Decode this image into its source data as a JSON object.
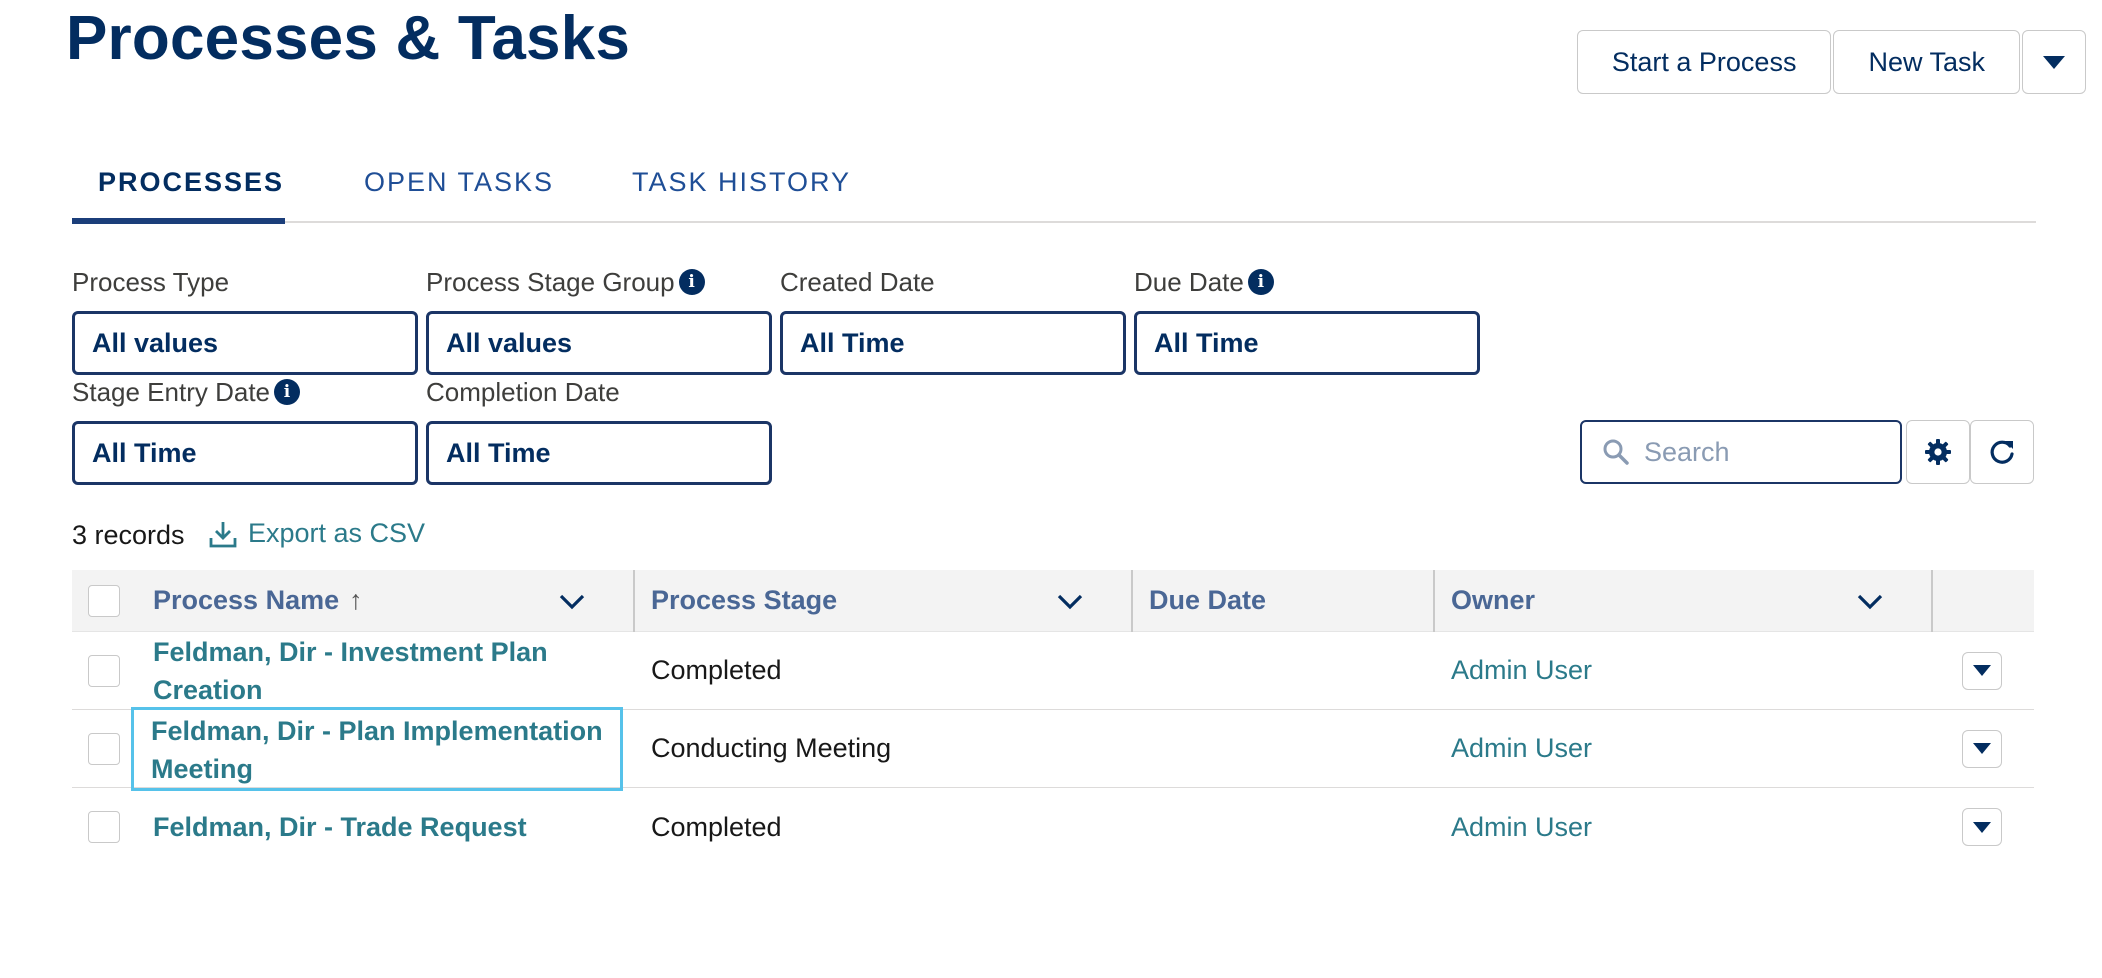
{
  "page": {
    "title": "Processes & Tasks"
  },
  "header_actions": {
    "start_process": "Start a Process",
    "new_task": "New Task"
  },
  "tabs": [
    {
      "label": "PROCESSES",
      "active": true
    },
    {
      "label": "OPEN TASKS",
      "active": false
    },
    {
      "label": "TASK HISTORY",
      "active": false
    }
  ],
  "filters": [
    {
      "label": "Process Type",
      "value": "All values",
      "info": false
    },
    {
      "label": "Process Stage Group",
      "value": "All values",
      "info": true
    },
    {
      "label": "Created Date",
      "value": "All Time",
      "info": false
    },
    {
      "label": "Due Date",
      "value": "All Time",
      "info": true
    },
    {
      "label": "Stage Entry Date",
      "value": "All Time",
      "info": true
    },
    {
      "label": "Completion Date",
      "value": "All Time",
      "info": false
    }
  ],
  "search": {
    "placeholder": "Search"
  },
  "records": {
    "count_text": "3 records",
    "export_label": "Export as CSV"
  },
  "table": {
    "columns": [
      "Process Name",
      "Process Stage",
      "Due Date",
      "Owner"
    ],
    "sort_indicator": "↑",
    "rows": [
      {
        "name_line1": "Feldman, Dir - Investment Plan",
        "name_line2": "Creation",
        "stage": "Completed",
        "due_date": "",
        "owner": "Admin User"
      },
      {
        "name_line1": "Feldman, Dir - Plan Implementation",
        "name_line2": "Meeting",
        "stage": "Conducting Meeting",
        "due_date": "",
        "owner": "Admin User"
      },
      {
        "name_line1": "Feldman, Dir - Trade Request",
        "name_line2": "",
        "stage": "Completed",
        "due_date": "",
        "owner": "Admin User"
      }
    ]
  },
  "colors": {
    "brand_navy": "#032d60",
    "link_teal": "#2b7a8a",
    "focus_ring": "#56c2ea"
  },
  "icons": [
    "caret-down-icon",
    "info-icon",
    "search-icon",
    "gear-icon",
    "refresh-icon",
    "download-icon",
    "chevron-down-icon",
    "sort-arrow-up-icon"
  ]
}
